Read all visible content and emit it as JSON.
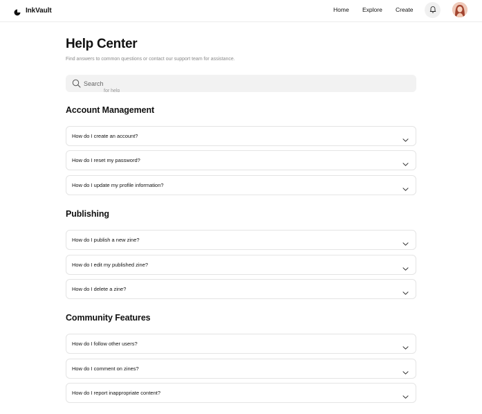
{
  "header": {
    "brand": "InkVault",
    "nav": [
      "Home",
      "Explore",
      "Create"
    ],
    "icons": {
      "logo": "inkvault-logo-icon",
      "notifications": "bell-icon",
      "avatar": "user-avatar"
    }
  },
  "page": {
    "title": "Help Center",
    "subtitle": "Find answers to common questions or contact our support team for assistance."
  },
  "search": {
    "placeholder": "Search",
    "ghost_text": "for help",
    "icon": "search-icon"
  },
  "sections": [
    {
      "title": "Account Management",
      "questions": [
        "How do I create an account?",
        "How do I reset my password?",
        "How do I update my profile information?"
      ]
    },
    {
      "title": "Publishing",
      "questions": [
        "How do I publish a new zine?",
        "How do I edit my published zine?",
        "How do I delete a zine?"
      ]
    },
    {
      "title": "Community Features",
      "questions": [
        "How do I follow other users?",
        "How do I comment on zines?",
        "How do I report inappropriate content?"
      ]
    }
  ],
  "colors": {
    "accent": "#111111",
    "muted": "#8a8a8a",
    "border": "#e4e4e4",
    "search_bg": "#f2f2f2"
  }
}
